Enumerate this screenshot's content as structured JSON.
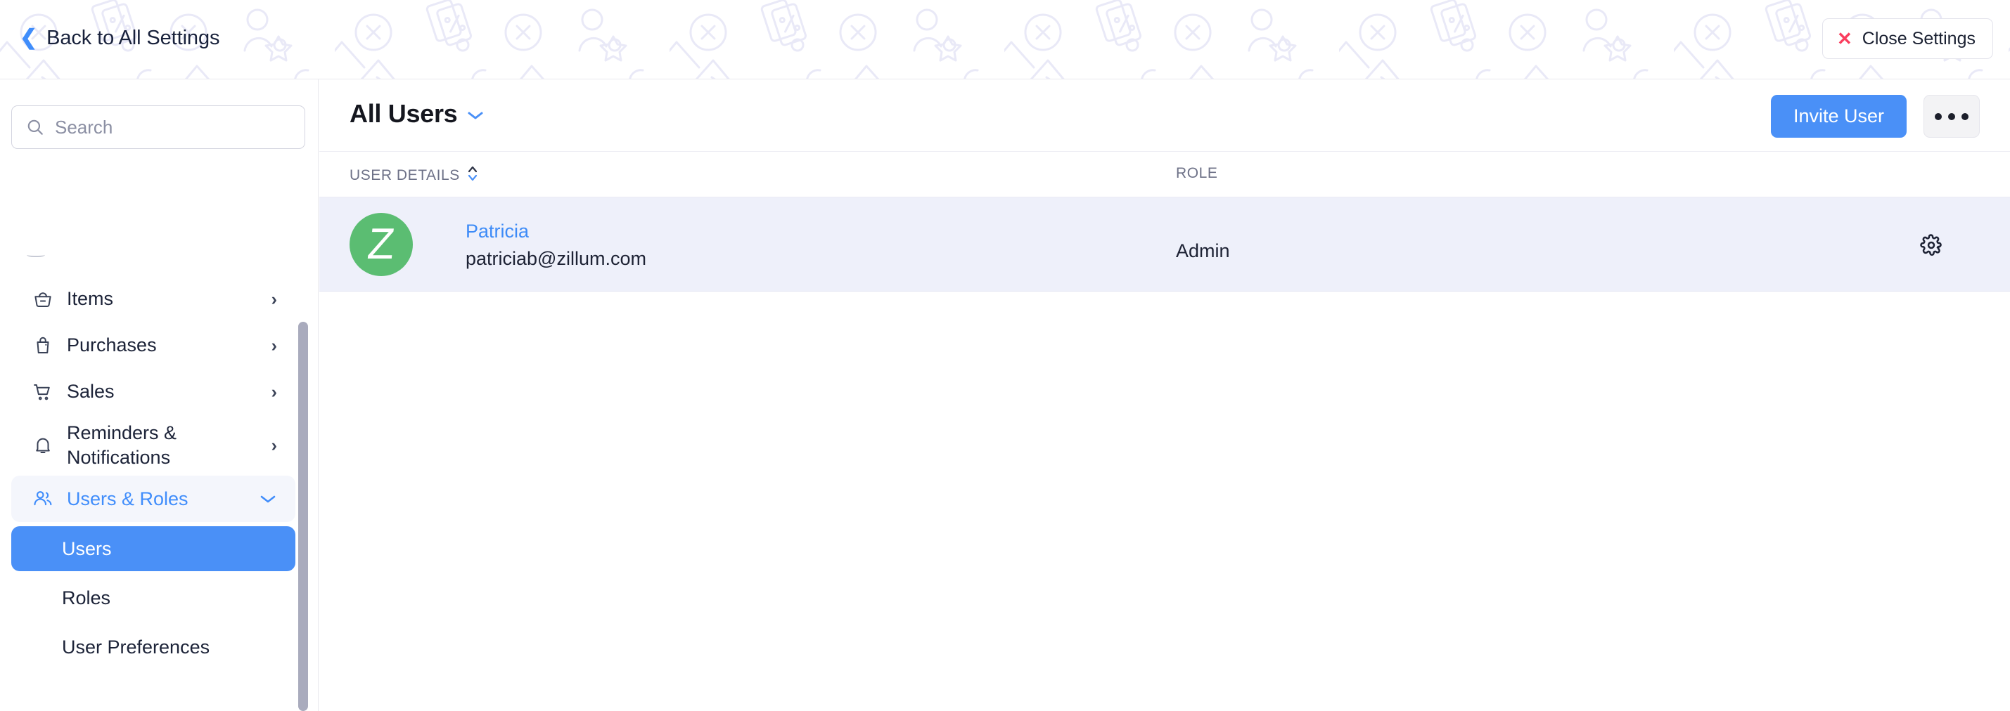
{
  "topbar": {
    "back_label": "Back to All Settings",
    "back_icon": "chevron-left-icon",
    "close_label": "Close Settings",
    "close_icon": "close-x-icon"
  },
  "sidebar": {
    "search": {
      "placeholder": "Search",
      "value": "",
      "icon": "search-icon"
    },
    "items": [
      {
        "label": "Items",
        "icon": "basket-icon",
        "chevron": "›",
        "state": "collapsed"
      },
      {
        "label": "Purchases",
        "icon": "bag-icon",
        "chevron": "›",
        "state": "collapsed"
      },
      {
        "label": "Sales",
        "icon": "cart-icon",
        "chevron": "›",
        "state": "collapsed"
      },
      {
        "label": "Reminders & Notifications",
        "icon": "bell-icon",
        "chevron": "›",
        "state": "collapsed"
      },
      {
        "label": "Users & Roles",
        "icon": "users-icon",
        "chevron": "∨",
        "state": "expanded"
      }
    ],
    "sub_items": [
      {
        "label": "Users",
        "active": true
      },
      {
        "label": "Roles",
        "active": false
      },
      {
        "label": "User Preferences",
        "active": false
      }
    ]
  },
  "main": {
    "title": "All Users",
    "title_caret_icon": "chevron-down-icon",
    "invite_label": "Invite User",
    "more_icon": "ellipsis-icon",
    "table": {
      "columns": [
        {
          "key": "user_details",
          "label": "USER DETAILS",
          "sortable": true,
          "sort_icon": "sort-updown-icon"
        },
        {
          "key": "role",
          "label": "ROLE",
          "sortable": false
        }
      ],
      "rows": [
        {
          "avatar_letter": "Z",
          "avatar_color": "#5bbd72",
          "name": "Patricia",
          "email": "patriciab@zillum.com",
          "role": "Admin",
          "settings_icon": "gear-icon"
        }
      ]
    }
  },
  "colors": {
    "accent_blue": "#4a90f7",
    "link_blue": "#3d8bf7",
    "close_red": "#fa3e5e",
    "row_bg": "#eef0fa",
    "avatar_green": "#5bbd72",
    "text_dark": "#1d2234",
    "text_muted": "#6d7187"
  }
}
